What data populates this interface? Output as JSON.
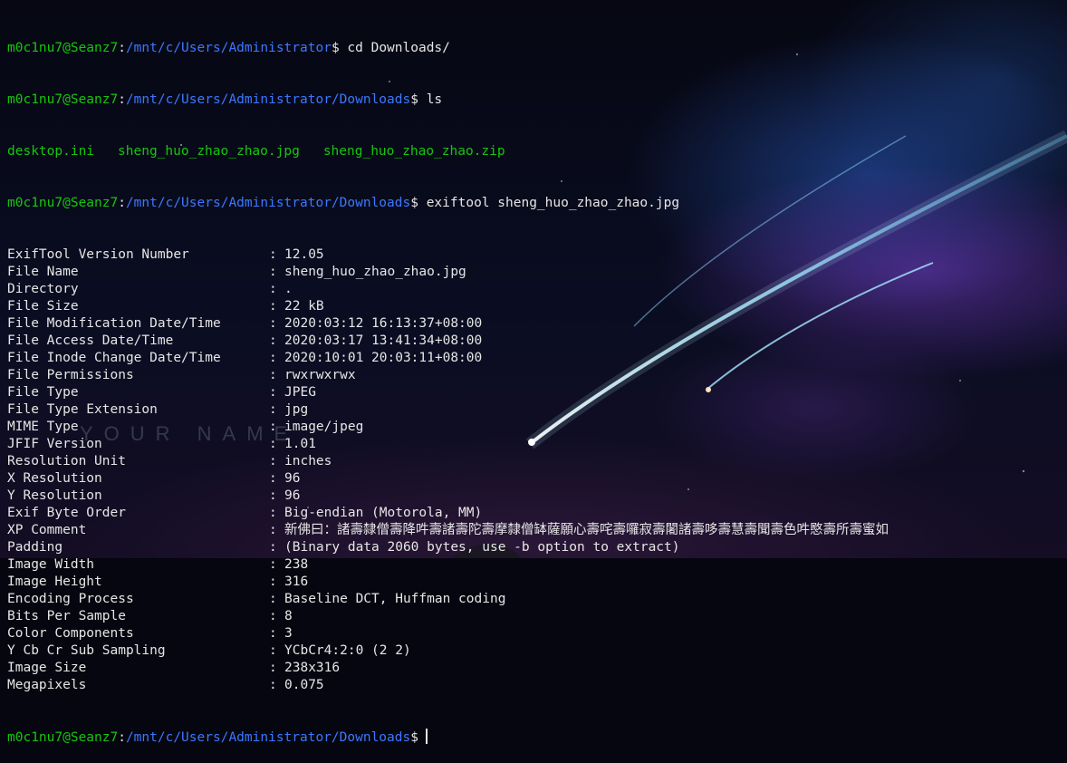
{
  "prompt": {
    "user": "m0c1nu7@Seanz7",
    "path": "/mnt/c/Users/Administrator",
    "downloads_path": "/mnt/c/Users/Administrator/Downloads"
  },
  "commands": {
    "cd": "cd Downloads/",
    "ls": "ls",
    "exiftool": "exiftool sheng_huo_zhao_zhao.jpg"
  },
  "ls_output": [
    "desktop.ini",
    "sheng_huo_zhao_zhao.jpg",
    "sheng_huo_zhao_zhao.zip"
  ],
  "exif": [
    {
      "key": "ExifTool Version Number",
      "value": "12.05"
    },
    {
      "key": "File Name",
      "value": "sheng_huo_zhao_zhao.jpg"
    },
    {
      "key": "Directory",
      "value": "."
    },
    {
      "key": "File Size",
      "value": "22 kB"
    },
    {
      "key": "File Modification Date/Time",
      "value": "2020:03:12 16:13:37+08:00"
    },
    {
      "key": "File Access Date/Time",
      "value": "2020:03:17 13:41:34+08:00"
    },
    {
      "key": "File Inode Change Date/Time",
      "value": "2020:10:01 20:03:11+08:00"
    },
    {
      "key": "File Permissions",
      "value": "rwxrwxrwx"
    },
    {
      "key": "File Type",
      "value": "JPEG"
    },
    {
      "key": "File Type Extension",
      "value": "jpg"
    },
    {
      "key": "MIME Type",
      "value": "image/jpeg"
    },
    {
      "key": "JFIF Version",
      "value": "1.01"
    },
    {
      "key": "Resolution Unit",
      "value": "inches"
    },
    {
      "key": "X Resolution",
      "value": "96"
    },
    {
      "key": "Y Resolution",
      "value": "96"
    },
    {
      "key": "Exif Byte Order",
      "value": "Big-endian (Motorola, MM)"
    },
    {
      "key": "XP Comment",
      "value": "新佛曰：諸壽隸僧壽降吽壽諸壽陀壽摩隸僧缽薩願心壽咤壽囉寂壽闍諸壽哆壽慧壽聞壽色吽愍壽所壽蜜如"
    },
    {
      "key": "Padding",
      "value": "(Binary data 2060 bytes, use -b option to extract)"
    },
    {
      "key": "Image Width",
      "value": "238"
    },
    {
      "key": "Image Height",
      "value": "316"
    },
    {
      "key": "Encoding Process",
      "value": "Baseline DCT, Huffman coding"
    },
    {
      "key": "Bits Per Sample",
      "value": "8"
    },
    {
      "key": "Color Components",
      "value": "3"
    },
    {
      "key": "Y Cb Cr Sub Sampling",
      "value": "YCbCr4:2:0 (2 2)"
    },
    {
      "key": "Image Size",
      "value": "238x316"
    },
    {
      "key": "Megapixels",
      "value": "0.075"
    }
  ],
  "separator": ":",
  "watermark": "YOUR NAME",
  "colors": {
    "user": "#16c60c",
    "path": "#3b78ff",
    "text": "#e6e6e6"
  }
}
